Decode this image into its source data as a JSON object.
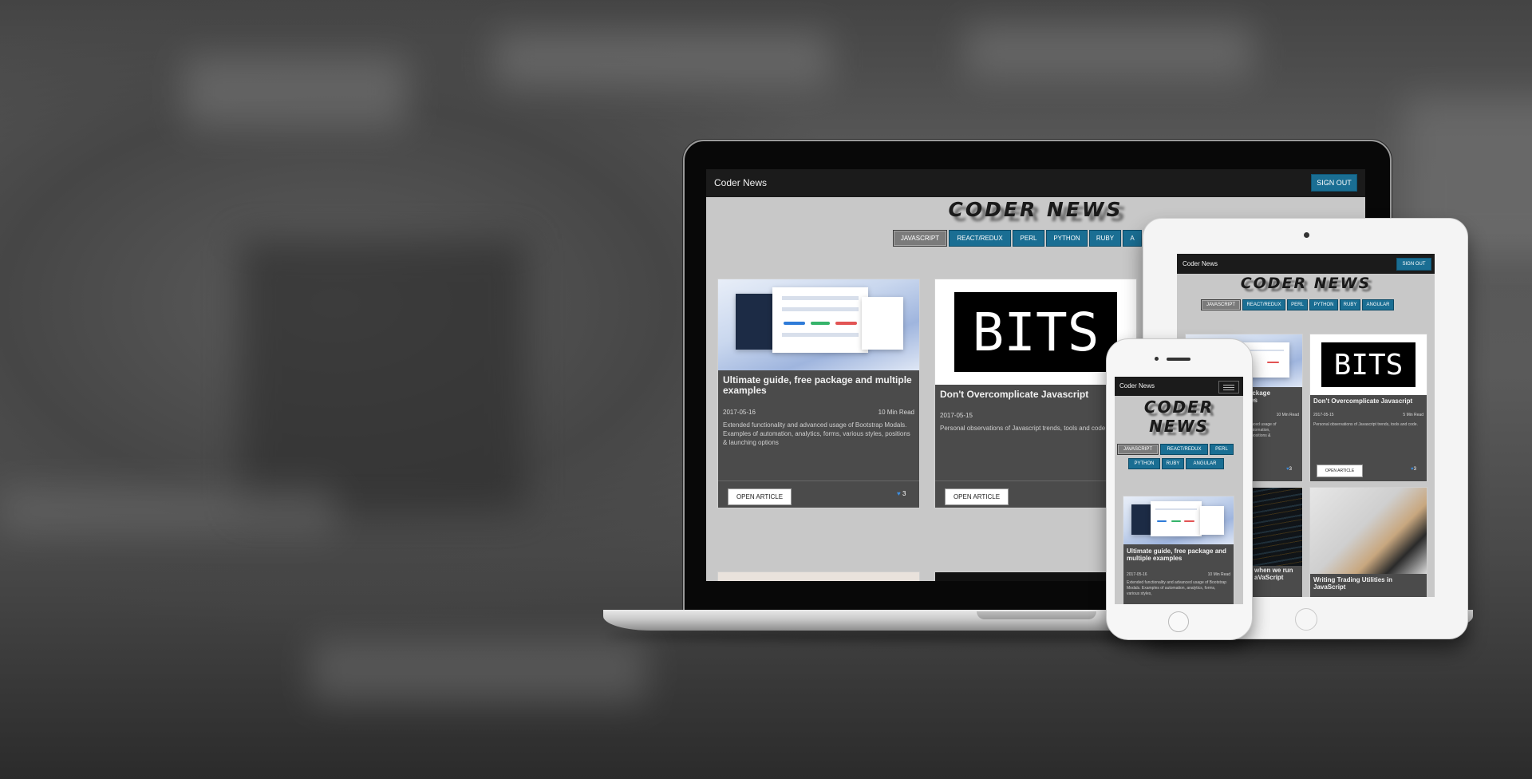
{
  "site": {
    "brand": "Coder News",
    "sign_out": "SIGN OUT",
    "heading": "CODER NEWS",
    "heading_line1": "CODER",
    "heading_line2": "NEWS",
    "tabs": [
      "JAVASCRIPT",
      "REACT/REDUX",
      "PERL",
      "PYTHON",
      "RUBY",
      "ANGULAR"
    ],
    "laptop_partial_tab": "A",
    "active_tab": "JAVASCRIPT"
  },
  "articles": [
    {
      "title": "Ultimate guide, free package and multiple examples",
      "date": "2017-05-16",
      "read_time": "10 Min Read",
      "description": "Extended functionality and advanced usage of Bootstrap Modals. Examples of automation, analytics, forms, various styles, positions & launching options",
      "button": "OPEN ARTICLE",
      "likes": "3"
    },
    {
      "title": "Don't Overcomplicate Javascript",
      "date": "2017-05-15",
      "read_time": "5 Min Read",
      "description": "Personal observations of Javascript trends, tools and code.",
      "button": "OPEN ARTICLE",
      "likes": "3",
      "thumb_text": "BITS"
    }
  ],
  "laptop_text": {
    "card2_desc": "Personal observations of Javascript trends, tools and code",
    "card2_read_partial": "5"
  },
  "tablet_text": {
    "card1_title_visible": "package\nples",
    "card1_read": "10 Min Read",
    "card1_desc_visible": "dvanced usage of\nof automation,\nes, positions &",
    "card3_title_visible": "when we run\naVaScript",
    "card4_title": "Writing Trading Utilities in JavaScript",
    "card4_title_visible": "Writing Trading Utilities in\nJavaScript"
  },
  "phone_text": {
    "card_title": "Ultimate guide, free package and multiple examples",
    "card_date": "2017-05-16",
    "card_read": "10 Min Read",
    "card_desc": "Extended functionality and advanced usage of Bootstrap Modals. Examples of automation, analytics, forms, various styles,"
  },
  "colors": {
    "nav": "#1b1b1b",
    "button_blue": "#1a6e93",
    "active_tab": "#7b7b7b",
    "card": "#4b4b4b",
    "page_bg": "#c8c8c8",
    "like_heart": "#3d8ee0"
  },
  "icons": [
    "heart-icon",
    "hamburger-icon"
  ]
}
